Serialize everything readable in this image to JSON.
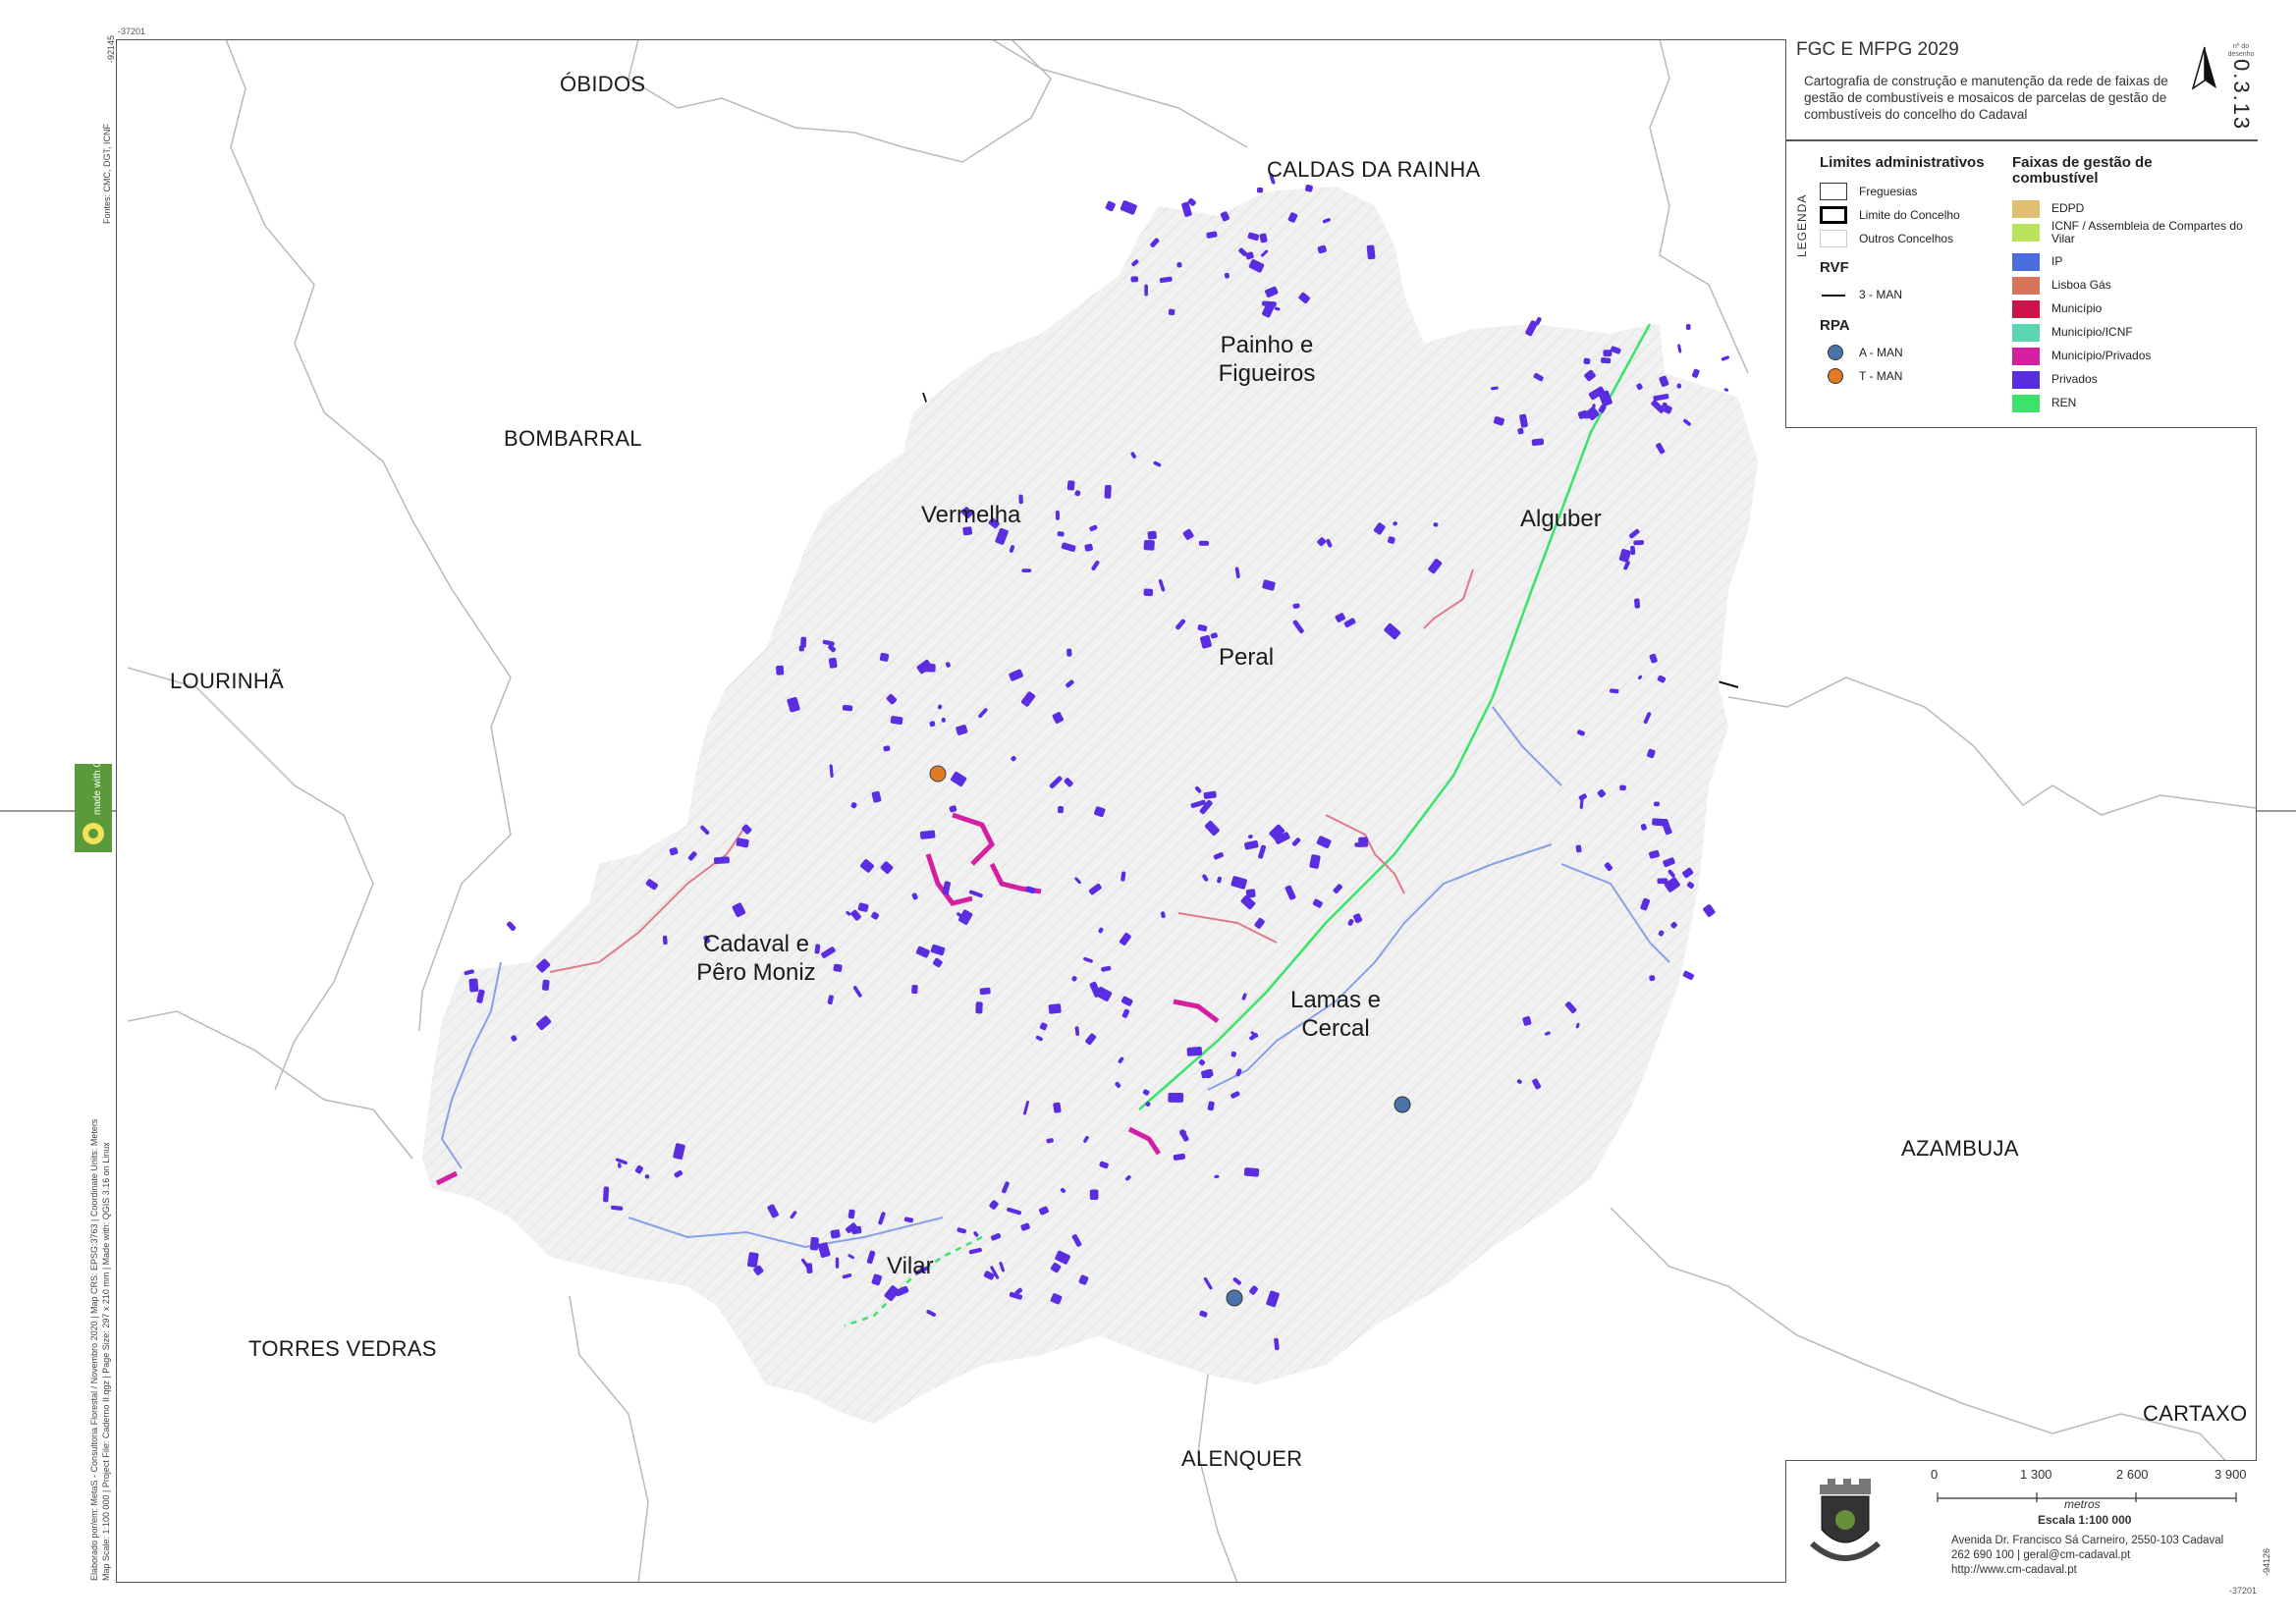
{
  "title": "FGC E MFPG 2029",
  "subtitle": "Cartografia de construção e manutenção da rede de faixas de gestão de combustíveis e mosaicos de parcelas de gestão de combustíveis do concelho do Cadaval",
  "sheet_number": "0.3.13",
  "sheet_number_label": "nº do desenho",
  "legend_title": "LEGENDA",
  "legend": {
    "admin": {
      "heading": "Limites administrativos",
      "items": [
        "Freguesias",
        "Limite do Concelho",
        "Outros Concelhos"
      ]
    },
    "rvf": {
      "heading": "RVF",
      "items": [
        "3 - MAN"
      ]
    },
    "rpa": {
      "heading": "RPA",
      "items": [
        {
          "label": "A - MAN",
          "color": "#4a74a8"
        },
        {
          "label": "T - MAN",
          "color": "#e07a26"
        }
      ]
    },
    "fgc": {
      "heading": "Faixas de gestão de combustível",
      "items": [
        {
          "label": "EDPD",
          "color": "#e0c070"
        },
        {
          "label": "ICNF / Assembleia de Compartes do Vilar",
          "color": "#b9e35a"
        },
        {
          "label": "IP",
          "color": "#4a6ee0"
        },
        {
          "label": "Lisboa Gás",
          "color": "#d9745a"
        },
        {
          "label": "Município",
          "color": "#d0124a"
        },
        {
          "label": "Município/ICNF",
          "color": "#5ad6b0"
        },
        {
          "label": "Município/Privados",
          "color": "#d41fa2"
        },
        {
          "label": "Privados",
          "color": "#5b2de0"
        },
        {
          "label": "REN",
          "color": "#3be36a"
        }
      ]
    }
  },
  "neighbors": [
    "ÓBIDOS",
    "CALDAS DA RAINHA",
    "BOMBARRAL",
    "LOURINHÃ",
    "TORRES VEDRAS",
    "ALENQUER",
    "AZAMBUJA",
    "CARTAXO"
  ],
  "parishes": [
    "Painho e Figueiros",
    "Vermelha",
    "Alguber",
    "Peral",
    "Cadaval e Pêro Moniz",
    "Lamas e Cercal",
    "Vilar"
  ],
  "scale": {
    "ticks": [
      "0",
      "1 300",
      "2 600",
      "3 900"
    ],
    "unit": "metros",
    "label": "Escala 1:100 000"
  },
  "address": {
    "line1": "Avenida Dr. Francisco Sá Carneiro, 2550-103 Cadaval",
    "line2": "262 690 100 | geral@cm-cadaval.pt",
    "line3": "http://www.cm-cadaval.pt"
  },
  "coords": {
    "top_left": "-37201",
    "left_top": "-92145",
    "right_bottom": "-94126",
    "bottom_right": "-37201"
  },
  "side_notes": {
    "sources": "Fontes: CMC, DGT, ICNF",
    "credits": "Elaborado por/em: MetaS - Consultoria Florestal / Novembro 2020 | Map CRS: EPSG:3763 | Coordinate Units: Meters",
    "credits2": "Map Scale: 1:100 000 | Project File: Caderno II.qgz | Page Size: 297 x 210 mm | Made with: QGIS 3.16 on Linux",
    "badge": "made with QGIS"
  },
  "colors": {
    "privados": "#5b2de0",
    "municipio_privados": "#d41fa2",
    "ren": "#3be36a",
    "lisboa_gas": "#d9745a",
    "ip": "#6d8fe0",
    "rpa_a": "#4a74a8",
    "rpa_t": "#e07a26"
  }
}
